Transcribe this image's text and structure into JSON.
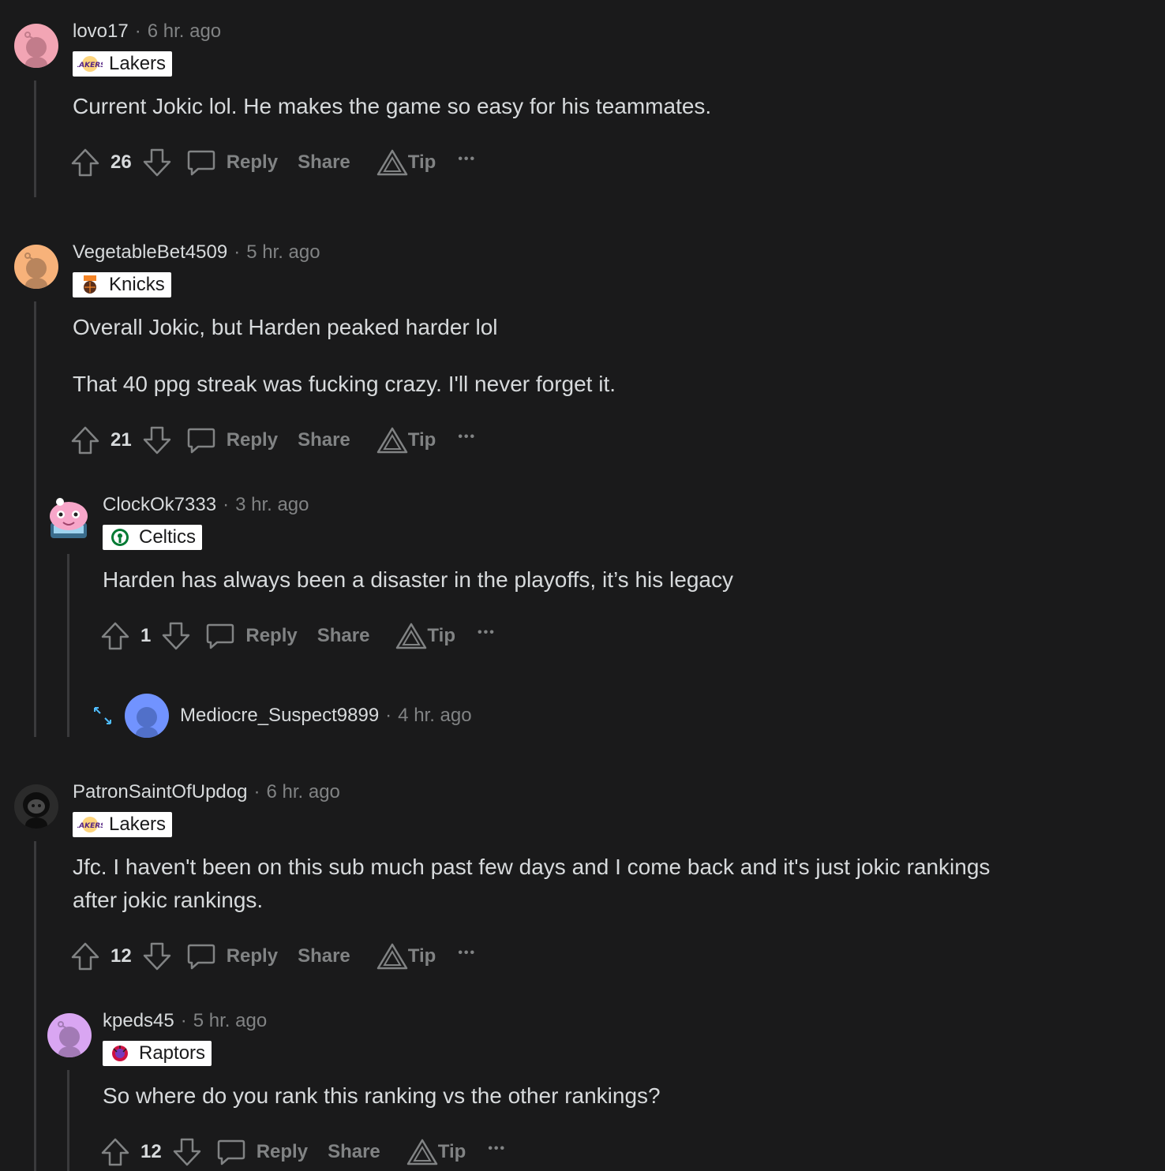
{
  "comments": [
    {
      "username": "lovo17",
      "time": "6 hr. ago",
      "flair": "Lakers",
      "lines": [
        "Current Jokic lol. He makes the game so easy for his teammates."
      ],
      "score": "26"
    },
    {
      "username": "VegetableBet4509",
      "time": "5 hr. ago",
      "flair": "Knicks",
      "lines": [
        "Overall Jokic, but Harden peaked harder lol",
        "That 40 ppg streak was fucking crazy. I'll never forget it."
      ],
      "score": "21"
    },
    {
      "username": "ClockOk7333",
      "time": "3 hr. ago",
      "flair": "Celtics",
      "lines": [
        "Harden has always been a disaster in the playoffs, it’s his legacy"
      ],
      "score": "1"
    },
    {
      "username": "PatronSaintOfUpdog",
      "time": "6 hr. ago",
      "flair": "Lakers",
      "lines": [
        "Jfc. I haven't been on this sub much past few days and I come back and it's just jokic rankings",
        "after jokic rankings."
      ],
      "score": "12"
    },
    {
      "username": "kpeds45",
      "time": "5 hr. ago",
      "flair": "Raptors",
      "lines": [
        "So where do you rank this ranking vs the other rankings?"
      ],
      "score": "12"
    }
  ],
  "collapsed": {
    "username": "Mediocre_Suspect9899",
    "time": "4 hr. ago"
  },
  "labels": {
    "reply": "Reply",
    "share": "Share",
    "tip": "Tip",
    "dot": "·",
    "more": "•••"
  },
  "colors": {
    "background": "#1a1a1b",
    "text": "#d7dadc",
    "muted": "#818384",
    "thread_line": "#3a3a3c",
    "expand_icon": "#4fbcff"
  },
  "icons": {
    "upvote": "upvote-icon",
    "downvote": "downvote-icon",
    "reply": "comment-bubble-icon",
    "tip": "tip-triangle-icon",
    "more": "more-options-icon",
    "expand": "expand-arrows-icon"
  }
}
